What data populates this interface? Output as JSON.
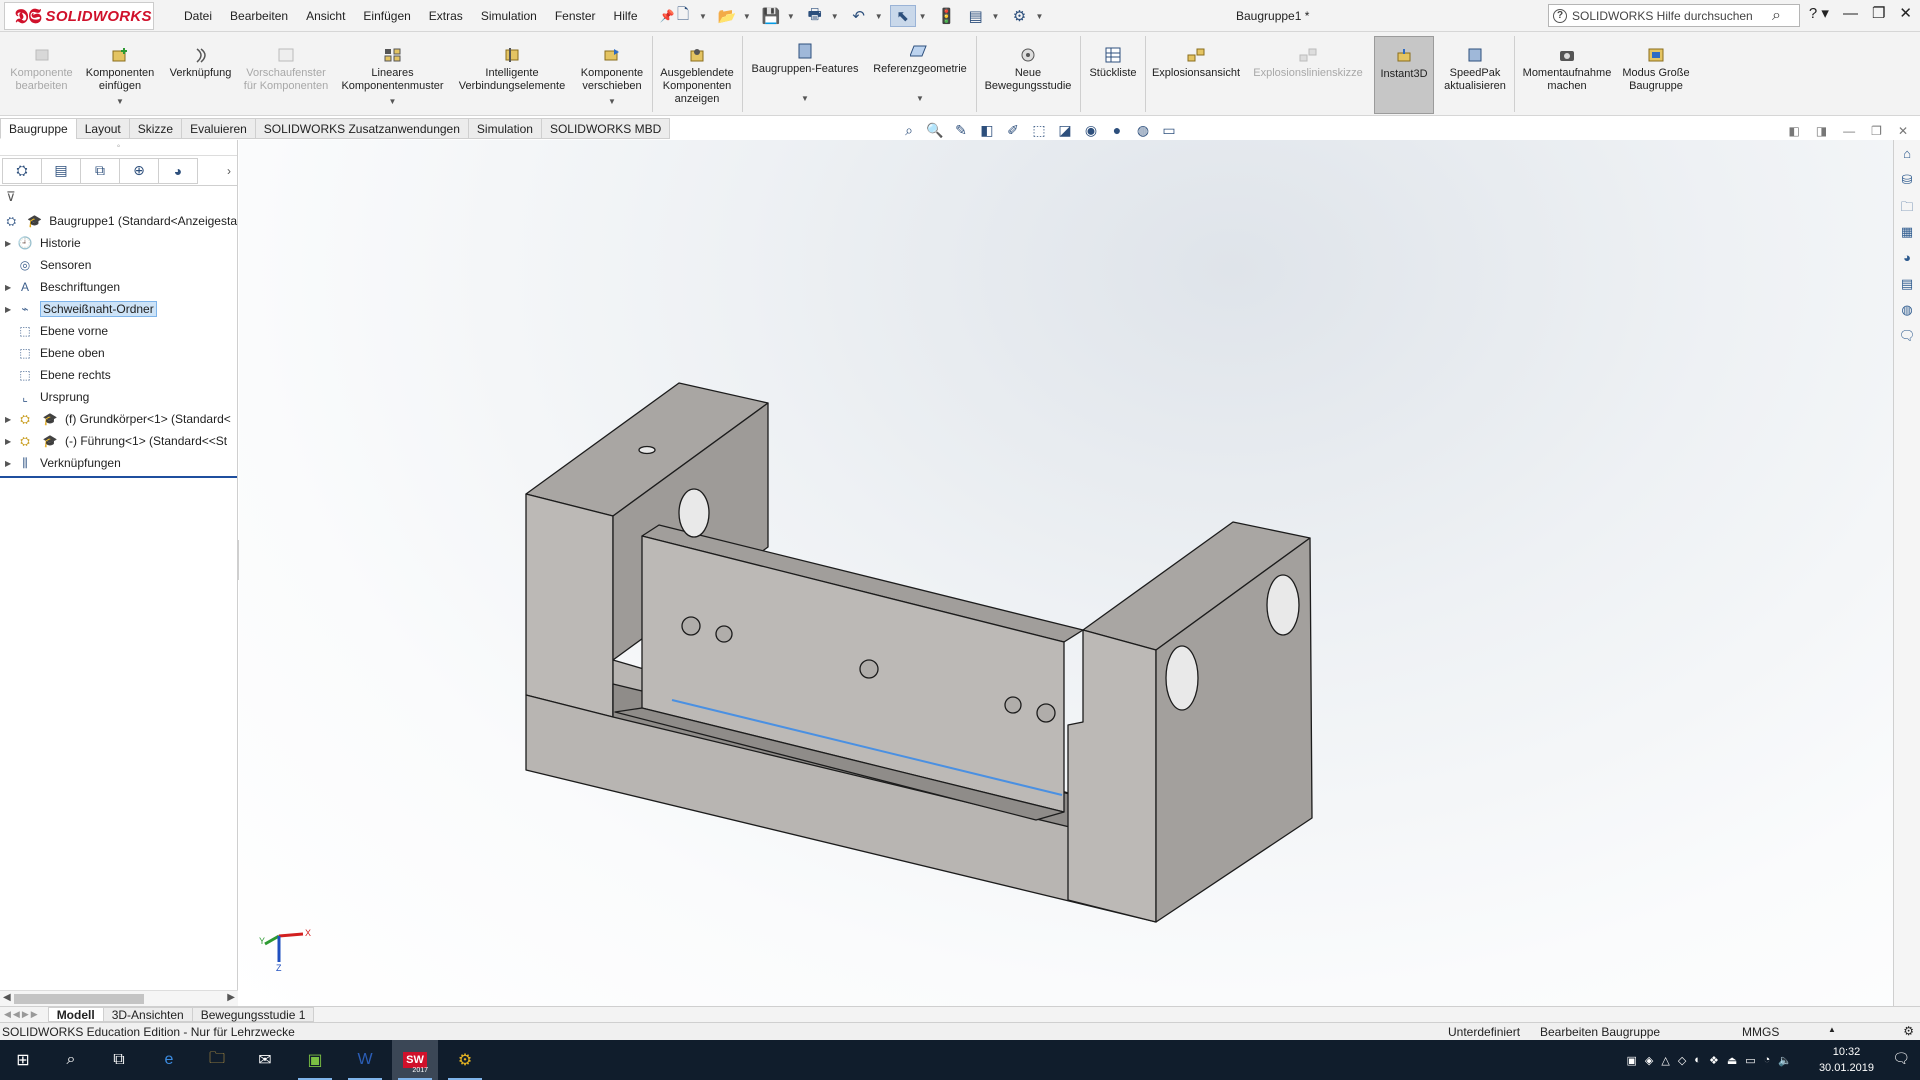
{
  "app": {
    "logo_ds": "3DS",
    "logo_text": "SOLIDWORKS",
    "menu": [
      "Datei",
      "Bearbeiten",
      "Ansicht",
      "Einfügen",
      "Extras",
      "Simulation",
      "Fenster",
      "Hilfe"
    ],
    "document_title": "Baugruppe1 *",
    "search_placeholder": "SOLIDWORKS Hilfe durchsuchen",
    "help_label": "?"
  },
  "ribbon": {
    "buttons": [
      {
        "label": "Komponente bearbeiten",
        "icon": "edit-component-icon",
        "enabled": false
      },
      {
        "label": "Komponenten einfügen",
        "icon": "insert-components-icon",
        "enabled": true
      },
      {
        "label": "Verknüpfung",
        "icon": "mate-icon",
        "enabled": true
      },
      {
        "label": "Vorschaufenster für Komponenten",
        "icon": "component-preview-icon",
        "enabled": false
      },
      {
        "label": "Lineares Komponentenmuster",
        "icon": "linear-pattern-icon",
        "enabled": true
      },
      {
        "label": "Intelligente Verbindungselemente",
        "icon": "smart-fasteners-icon",
        "enabled": true
      },
      {
        "label": "Komponente verschieben",
        "icon": "move-component-icon",
        "enabled": true
      },
      {
        "label": "Ausgeblendete Komponenten anzeigen",
        "icon": "show-hidden-icon",
        "enabled": true
      },
      {
        "label": "Baugruppen-Features",
        "icon": "assembly-features-icon",
        "enabled": true
      },
      {
        "label": "Referenzgeometrie",
        "icon": "reference-geometry-icon",
        "enabled": true
      },
      {
        "label": "Neue Bewegungsstudie",
        "icon": "motion-study-icon",
        "enabled": true
      },
      {
        "label": "Stückliste",
        "icon": "bom-icon",
        "enabled": true
      },
      {
        "label": "Explosionsansicht",
        "icon": "exploded-view-icon",
        "enabled": true
      },
      {
        "label": "Explosionslinienskizze",
        "icon": "explode-line-sketch-icon",
        "enabled": false
      },
      {
        "label": "Instant3D",
        "icon": "instant3d-icon",
        "enabled": true
      },
      {
        "label": "SpeedPak aktualisieren",
        "icon": "speedpak-icon",
        "enabled": true
      },
      {
        "label": "Momentaufnahme machen",
        "icon": "snapshot-icon",
        "enabled": true
      },
      {
        "label": "Modus Große Baugruppe",
        "icon": "large-assembly-icon",
        "enabled": true
      }
    ]
  },
  "tabs": [
    "Baugruppe",
    "Layout",
    "Skizze",
    "Evaluieren",
    "SOLIDWORKS Zusatzanwendungen",
    "Simulation",
    "SOLIDWORKS MBD"
  ],
  "feature_tree": {
    "root": "Baugruppe1  (Standard<Anzeigesta",
    "items": [
      {
        "label": "Historie",
        "icon": "history-icon",
        "expandable": true
      },
      {
        "label": "Sensoren",
        "icon": "sensors-icon",
        "expandable": false
      },
      {
        "label": "Beschriftungen",
        "icon": "annotations-icon",
        "expandable": true
      },
      {
        "label": "Schweißnaht-Ordner",
        "icon": "weld-folder-icon",
        "expandable": true,
        "selected": true
      },
      {
        "label": "Ebene vorne",
        "icon": "plane-icon",
        "expandable": false
      },
      {
        "label": "Ebene oben",
        "icon": "plane-icon",
        "expandable": false
      },
      {
        "label": "Ebene rechts",
        "icon": "plane-icon",
        "expandable": false
      },
      {
        "label": "Ursprung",
        "icon": "origin-icon",
        "expandable": false
      },
      {
        "label": "(f) Grundkörper<1> (Standard<",
        "icon": "part-icon",
        "expandable": true
      },
      {
        "label": "(-) Führung<1> (Standard<<St",
        "icon": "part-icon",
        "expandable": true
      },
      {
        "label": "Verknüpfungen",
        "icon": "mates-folder-icon",
        "expandable": true
      }
    ]
  },
  "bottom_tabs": [
    "Modell",
    "3D-Ansichten",
    "Bewegungsstudie 1"
  ],
  "status": {
    "left": "SOLIDWORKS Education Edition - Nur für Lehrzwecke",
    "state": "Unterdefiniert",
    "mode": "Bearbeiten Baugruppe",
    "units": "MMGS",
    "units_arrow": "▲"
  },
  "triad": {
    "x": "X",
    "y": "Y",
    "z": "Z"
  },
  "taskbar": {
    "time": "10:32",
    "date": "30.01.2019",
    "sw_badge": "2017"
  },
  "colors": {
    "brand": "#d0112b",
    "selection": "#cde3f7",
    "taskbar": "#101d2c",
    "model_face_light": "#b9b6b3",
    "model_face_dark": "#9c9996",
    "model_edge_highlight": "#4a90e2"
  }
}
